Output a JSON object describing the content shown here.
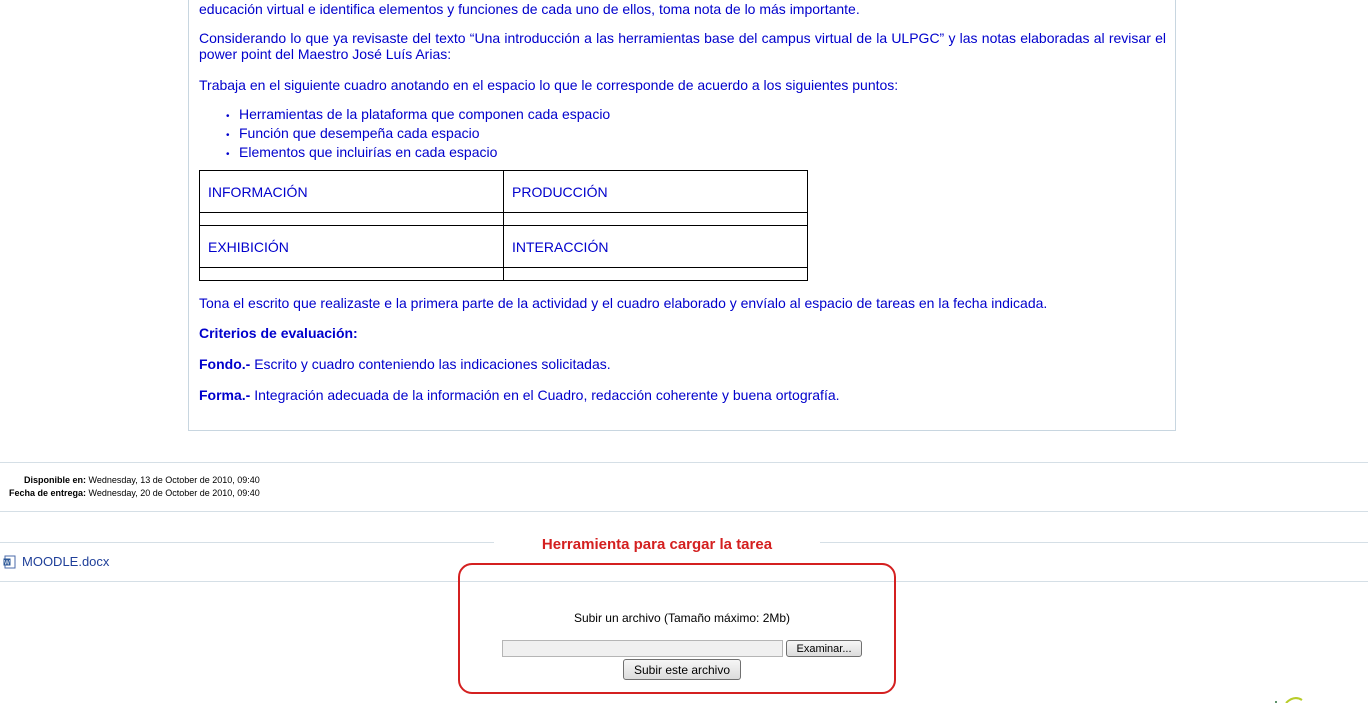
{
  "content": {
    "line_top": "educación virtual e identifica elementos y funciones de cada uno de ellos, toma nota de lo más importante.",
    "para_considerando": "Considerando lo que ya revisaste del texto “Una introducción a las herramientas base del campus virtual de la ULPGC” y las notas elaboradas al revisar el power point del Maestro José Luís Arias:",
    "para_trabaja": "Trabaja en el siguiente cuadro anotando en el espacio lo que le corresponde de acuerdo a los siguientes puntos:",
    "bullets": [
      "Herramientas de la plataforma que componen cada espacio",
      "Función que desempeña cada espacio",
      "Elementos que incluirías en cada espacio"
    ],
    "table": {
      "row1": [
        "INFORMACIÓN",
        "PRODUCCIÓN"
      ],
      "row2": [
        "EXHIBICIÓN",
        "INTERACCIÓN"
      ]
    },
    "para_tona": "Tona el escrito que realizaste e la primera parte de la actividad y el cuadro elaborado y envíalo al espacio de tareas en la fecha indicada.",
    "criterios": "Criterios de evaluación:",
    "fondo_label": "Fondo.-",
    "fondo_text": " Escrito y cuadro conteniendo las indicaciones solicitadas.",
    "forma_label": "Forma.-",
    "forma_text": " Integración adecuada de la información en el Cuadro, redacción coherente y buena ortografía."
  },
  "dates": {
    "available_label": "Disponible en:",
    "available_value": "Wednesday, 13 de October de 2010, 09:40",
    "due_label": "Fecha de entrega:",
    "due_value": "Wednesday, 20 de October de 2010, 09:40"
  },
  "annotation": {
    "title": "Herramienta para cargar la tarea",
    "color": "#d42020"
  },
  "file": {
    "name": "MOODLE.docx",
    "icon": "word-document-icon"
  },
  "upload": {
    "label": "Subir un archivo (Tamaño máximo: 2Mb)",
    "browse_button": "Examinar...",
    "submit_button": "Subir este archivo"
  },
  "colors": {
    "text_blue": "#0000cc",
    "link_blue": "#1f3f99",
    "rule": "#d5dfe6"
  }
}
